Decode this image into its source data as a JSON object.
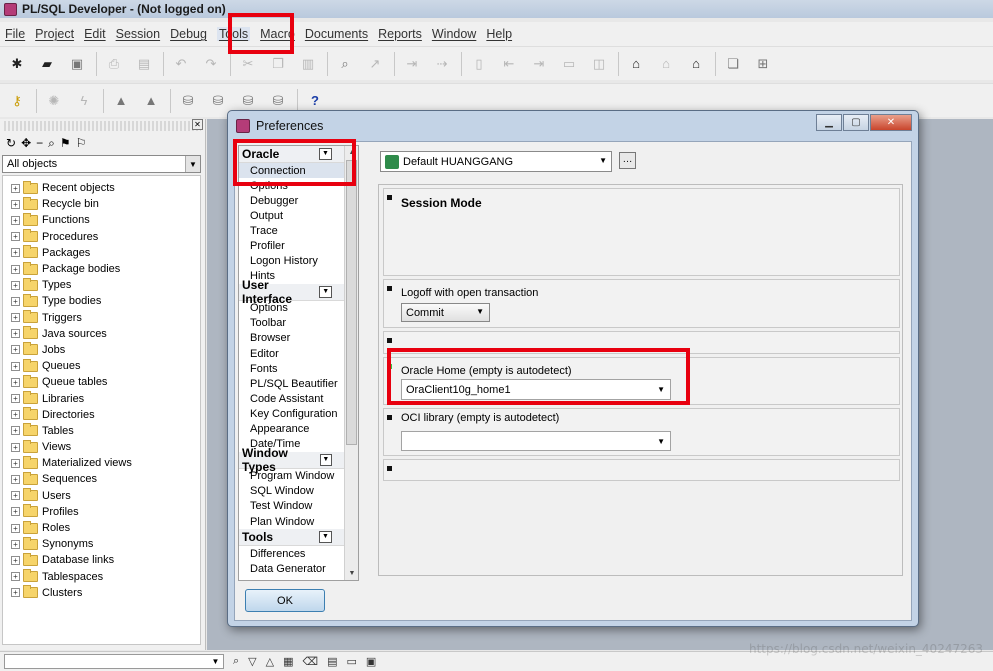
{
  "app": {
    "title": "PL/SQL Developer - (Not logged on)"
  },
  "menu": {
    "items": [
      "File",
      "Project",
      "Edit",
      "Session",
      "Debug",
      "Tools",
      "Macro",
      "Documents",
      "Reports",
      "Window",
      "Help"
    ]
  },
  "browser": {
    "filter": "All objects",
    "tree": [
      "Recent objects",
      "Recycle bin",
      "Functions",
      "Procedures",
      "Packages",
      "Package bodies",
      "Types",
      "Type bodies",
      "Triggers",
      "Java sources",
      "Jobs",
      "Queues",
      "Queue tables",
      "Libraries",
      "Directories",
      "Tables",
      "Views",
      "Materialized views",
      "Sequences",
      "Users",
      "Profiles",
      "Roles",
      "Synonyms",
      "Database links",
      "Tablespaces",
      "Clusters"
    ]
  },
  "dialog": {
    "title": "Preferences",
    "groups": {
      "oracle": {
        "title": "Oracle",
        "items": [
          "Connection",
          "Options",
          "Debugger",
          "Output",
          "Trace",
          "Profiler",
          "Logon History",
          "Hints"
        ]
      },
      "user_interface": {
        "title": "User Interface",
        "items": [
          "Options",
          "Toolbar",
          "Browser",
          "Editor",
          "Fonts",
          "PL/SQL Beautifier",
          "Code Assistant",
          "Key Configuration",
          "Appearance",
          "Date/Time"
        ]
      },
      "window_types": {
        "title": "Window Types",
        "items": [
          "Program Window",
          "SQL Window",
          "Test Window",
          "Plan Window"
        ]
      },
      "tools": {
        "title": "Tools",
        "items": [
          "Differences",
          "Data Generator"
        ]
      }
    },
    "selected_item": "Connection",
    "connection_profile": "Default HUANGGANG",
    "session_mode_title": "Session Mode",
    "logoff_label": "Logoff with open transaction",
    "logoff_value": "Commit",
    "oracle_home_label": "Oracle Home (empty is autodetect)",
    "oracle_home_value": "OraClient10g_home1",
    "oci_label": "OCI library (empty is autodetect)",
    "oci_value": "",
    "ok_label": "OK"
  },
  "watermark": "https://blog.csdn.net/weixin_40247263",
  "colors": {
    "highlight": "#e8000f",
    "dialog_frame": "#c3d3e6"
  }
}
